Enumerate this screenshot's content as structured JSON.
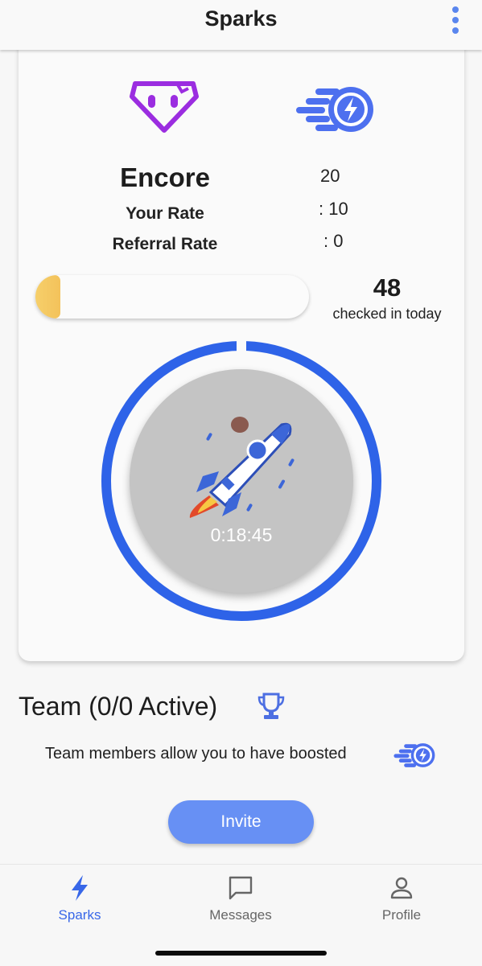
{
  "header": {
    "title": "Sparks"
  },
  "card": {
    "name": "Encore",
    "name_value": "20",
    "your_rate_label": "Your Rate",
    "your_rate_value": ": 10",
    "referral_rate_label": "Referral Rate",
    "referral_rate_value": ": 0",
    "progress_fraction": 0.09,
    "checked_in_count": "48",
    "checked_in_label": "checked in today",
    "timer": "0:18:45"
  },
  "team": {
    "title": "Team (0/0 Active)",
    "description": "Team members allow you to have boosted",
    "invite_label": "Invite"
  },
  "nav": {
    "items": [
      {
        "label": "Sparks",
        "icon": "bolt-icon",
        "active": true
      },
      {
        "label": "Messages",
        "icon": "chat-icon",
        "active": false
      },
      {
        "label": "Profile",
        "icon": "person-icon",
        "active": false
      }
    ]
  },
  "colors": {
    "accent": "#3867e8",
    "purple": "#9b2de0",
    "progress": "#f5c963",
    "invite": "#6790f4",
    "timer_circle": "#c4c4c4"
  }
}
